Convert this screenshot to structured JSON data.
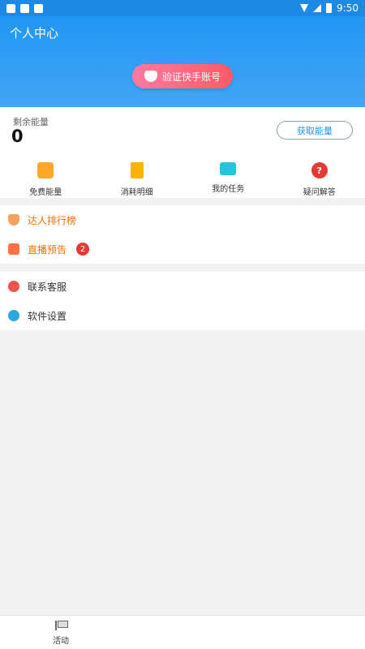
{
  "status_bar": {
    "time": "9:50",
    "left_icons": [
      "app-icon",
      "notification-icon",
      "sync-icon"
    ],
    "right_icons": [
      "wifi-icon",
      "signal-icon",
      "battery-icon"
    ]
  },
  "header": {
    "title": "个人中心",
    "verify_button": "验证快手账号"
  },
  "energy": {
    "label": "剩余能量",
    "value": "0",
    "get_button": "获取能量"
  },
  "features": [
    {
      "label": "免费能量",
      "icon": "gift-icon"
    },
    {
      "label": "消耗明细",
      "icon": "card-icon"
    },
    {
      "label": "我的任务",
      "icon": "task-icon"
    },
    {
      "label": "疑问解答",
      "icon": "question-icon"
    }
  ],
  "list1": [
    {
      "label": "达人排行榜",
      "icon": "medal-icon"
    },
    {
      "label": "直播预告",
      "icon": "live-icon",
      "badge": "2"
    }
  ],
  "list2": [
    {
      "label": "联系客服",
      "icon": "service-icon"
    },
    {
      "label": "软件设置",
      "icon": "settings-icon"
    }
  ],
  "bottom_nav": [
    {
      "label": "活动",
      "icon": "flag-icon"
    }
  ],
  "colors": {
    "primary": "#2196f3",
    "accent": "#ff5a66",
    "orange": "#ff6d00",
    "background": "#f2f2f2"
  }
}
